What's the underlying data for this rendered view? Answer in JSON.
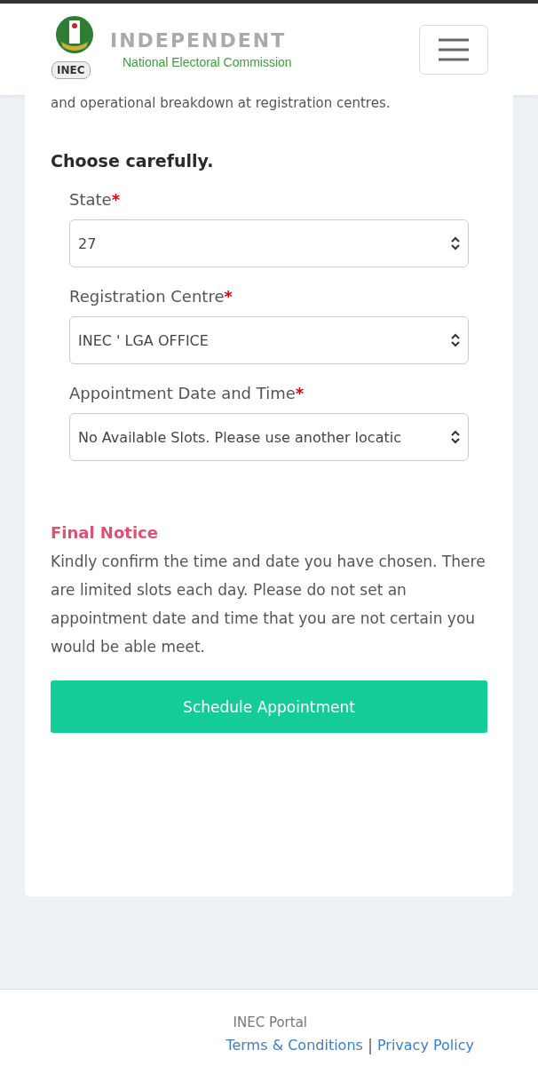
{
  "header": {
    "logo_badge": "INEC",
    "title": "INDEPENDENT",
    "subtitle": "National Electoral Commission"
  },
  "intro_tail": "and operational breakdown at registration centres.",
  "heading": "Choose carefully.",
  "fields": [
    {
      "label": "State",
      "required_mark": "*",
      "value": "27"
    },
    {
      "label": "Registration Centre",
      "required_mark": "*",
      "value": "INEC ' LGA OFFICE"
    },
    {
      "label": "Appointment Date and Time",
      "required_mark": "*",
      "value": "No Available Slots. Please use another locatic"
    }
  ],
  "notice": {
    "title": "Final Notice",
    "text": "Kindly confirm the time and date you have chosen. There are limited slots each day. Please do not set an appointment date and time that you are not certain you would be able meet."
  },
  "submit": "Schedule Appointment",
  "footer": {
    "brand": "INEC Portal",
    "links": [
      "Terms & Conditions",
      "Privacy Policy"
    ],
    "separator": "|"
  }
}
